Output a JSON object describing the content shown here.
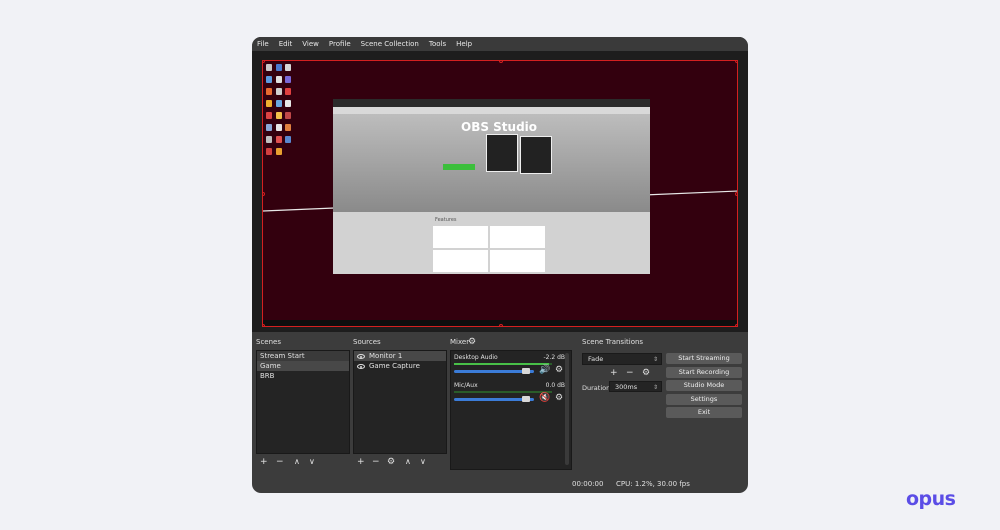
{
  "menubar": {
    "items": [
      "File",
      "Edit",
      "View",
      "Profile",
      "Scene Collection",
      "Tools",
      "Help"
    ]
  },
  "preview": {
    "browser_title": "OBS Studio",
    "features_label": "Features"
  },
  "scenes": {
    "title": "Scenes",
    "items": [
      "Stream Start",
      "Game",
      "BRB"
    ],
    "selected": "Game"
  },
  "sources": {
    "title": "Sources",
    "items": [
      "Monitor 1",
      "Game Capture"
    ]
  },
  "mixer": {
    "title": "Mixer",
    "channels": [
      {
        "name": "Desktop Audio",
        "db": "-2.2 dB",
        "level": 0.97,
        "volume": 0.9,
        "muted": false
      },
      {
        "name": "Mic/Aux",
        "db": "0.0 dB",
        "level": 0.0,
        "volume": 0.9,
        "muted": true
      }
    ]
  },
  "transitions": {
    "title": "Scene Transitions",
    "selected": "Fade",
    "duration_label": "Duration",
    "duration_value": "300ms"
  },
  "controls": {
    "buttons": [
      "Start Streaming",
      "Start Recording",
      "Studio Mode",
      "Settings",
      "Exit"
    ]
  },
  "status": {
    "time": "00:00:00",
    "cpu": "CPU: 1.2%, 30.00 fps"
  },
  "brand": {
    "logo_text": "opus",
    "color": "#5b4de6"
  },
  "colors": {
    "selection_border": "#d42020",
    "canvas_bg": "#33000e",
    "meter_green": "#48c048",
    "slider_blue": "#3b7cd8",
    "mute_red": "#d42020"
  }
}
